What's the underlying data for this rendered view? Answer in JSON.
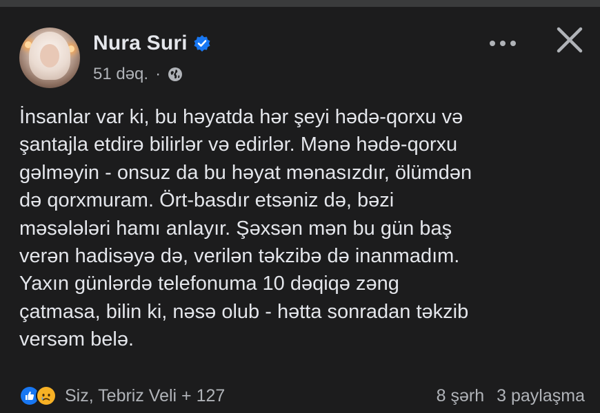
{
  "post": {
    "author": "Nura Suri",
    "time": "51 dəq.",
    "separator": "·",
    "privacy_icon": "globe-icon",
    "verified_icon": "verified-badge-icon",
    "text": "İnsanlar var ki, bu həyatda hər şeyi hədə-qorxu və\nşantajla etdirə bilirlər və edirlər. Mənə hədə-qorxu\ngəlməyin - onsuz da bu həyat mənasızdır, ölümdən\ndə qorxmuram. Ört-basdır etsəniz də, bəzi\nməsələləri hamı anlayır. Şəxsən mən bu gün baş\nverən hadisəyə də, verilən təkzibə də inanmadım.\nYaxın günlərdə telefonuma 10 dəqiqə zəng\nçatmasa, bilin ki, nəsə olub - hətta sonradan təkzib\nversəm belə."
  },
  "header_actions": {
    "more_icon": "more-dots-icon",
    "close_icon": "close-icon"
  },
  "footer": {
    "reactions_text": "Siz, Tebriz Veli + 127",
    "reaction_icons": [
      "like-icon",
      "sad-icon"
    ],
    "comments": "8 şərh",
    "shares": "3 paylaşma"
  },
  "colors": {
    "background": "#1c1c1d",
    "text": "#e4e6eb",
    "secondary_text": "#b0b3b8",
    "verified_blue": "#1877f2",
    "like_blue": "#1877f2",
    "sad_yellow": "#f7b125"
  }
}
